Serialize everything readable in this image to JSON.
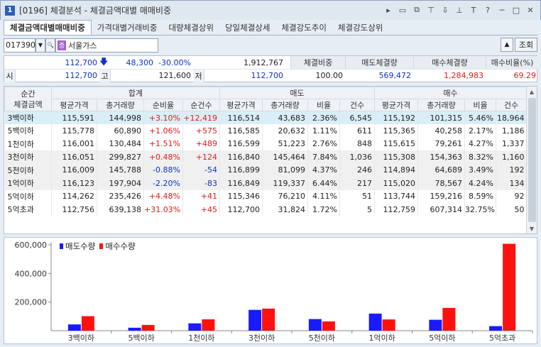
{
  "window": {
    "num": "1",
    "title": "[0196] 체결분석 - 체결금액대별 매매비중"
  },
  "tabs": [
    {
      "label": "체결금액대별매매비중"
    },
    {
      "label": "가격대별거래비중"
    },
    {
      "label": "대량체결상위"
    },
    {
      "label": "당일체결상세"
    },
    {
      "label": "체결강도추이"
    },
    {
      "label": "체결강도상위"
    }
  ],
  "toolbar": {
    "code": "017390",
    "name": "서울가스",
    "query_label": "조회"
  },
  "quote": {
    "price": "112,700",
    "change": "48,300",
    "change_rate": "-30.00%",
    "volume": "1,912,767",
    "open_label": "시",
    "open": "112,700",
    "high_label": "고",
    "high": "121,600",
    "low_label": "저",
    "low": "112,700",
    "headers": [
      "체결비중",
      "매도체결량",
      "매수체결량",
      "매수비율(%)"
    ],
    "values": [
      "100.00",
      "569,472",
      "1,284,983",
      "69.29"
    ]
  },
  "table": {
    "group_labels": {
      "range": "순간\n체결금액",
      "total": "합계",
      "sell": "매도",
      "buy": "매수"
    },
    "sub_total": [
      "평균가격",
      "총거래량",
      "순비율",
      "순건수"
    ],
    "sub_side": [
      "평균가격",
      "총거래량",
      "비율",
      "건수"
    ],
    "rows": [
      [
        "3백이하",
        "115,591",
        "144,998",
        "+3.10%",
        "+12,419",
        "116,514",
        "43,683",
        "2.36%",
        "6,545",
        "115,192",
        "101,315",
        "5.46%",
        "18,964"
      ],
      [
        "5백이하",
        "115,778",
        "60,890",
        "+1.06%",
        "+575",
        "116,585",
        "20,632",
        "1.11%",
        "611",
        "115,365",
        "40,258",
        "2.17%",
        "1,186"
      ],
      [
        "1천이하",
        "116,001",
        "130,484",
        "+1.51%",
        "+489",
        "116,599",
        "51,223",
        "2.76%",
        "848",
        "115,615",
        "79,261",
        "4.27%",
        "1,337"
      ],
      [
        "3천이하",
        "116,051",
        "299,827",
        "+0.48%",
        "+124",
        "116,840",
        "145,464",
        "7.84%",
        "1,036",
        "115,308",
        "154,363",
        "8.32%",
        "1,160"
      ],
      [
        "5천이하",
        "116,009",
        "145,788",
        "-0.88%",
        "-54",
        "116,899",
        "81,099",
        "4.37%",
        "246",
        "114,894",
        "64,689",
        "3.49%",
        "192"
      ],
      [
        "1억이하",
        "116,123",
        "197,904",
        "-2.20%",
        "-83",
        "116,849",
        "119,337",
        "6.44%",
        "217",
        "115,020",
        "78,567",
        "4.24%",
        "134"
      ],
      [
        "5억이하",
        "114,262",
        "235,426",
        "+4.48%",
        "+41",
        "115,346",
        "76,210",
        "4.11%",
        "51",
        "113,744",
        "159,216",
        "8.59%",
        "92"
      ],
      [
        "5억초과",
        "112,756",
        "639,138",
        "+31.03%",
        "+45",
        "112,700",
        "31,824",
        "1.72%",
        "5",
        "112,759",
        "607,314",
        "32.75%",
        "50"
      ]
    ]
  },
  "colors": {
    "sell": "#1a1aff",
    "buy": "#ff1010",
    "selected_row": "#d9eef6"
  },
  "chart_data": {
    "type": "bar",
    "categories": [
      "3백이하",
      "5백이하",
      "1천이하",
      "3천이하",
      "5천이하",
      "1억이하",
      "5억이하",
      "5억초과"
    ],
    "series": [
      {
        "name": "매도수량",
        "values": [
          43683,
          20632,
          51223,
          145464,
          81099,
          119337,
          76210,
          31824
        ]
      },
      {
        "name": "매수수량",
        "values": [
          101315,
          40258,
          79261,
          154363,
          64689,
          78567,
          159216,
          607314
        ]
      }
    ],
    "yticks": [
      "200,000",
      "400,000",
      "600,000"
    ],
    "ylim": [
      0,
      620000
    ],
    "legend": "top-left"
  }
}
